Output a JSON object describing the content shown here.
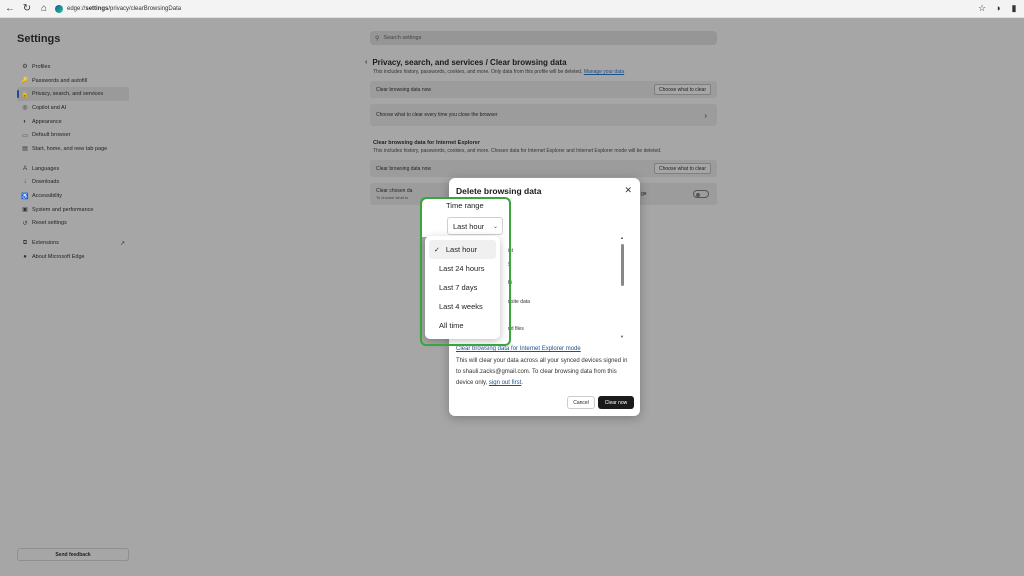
{
  "browser": {
    "url_prefix": "edge://",
    "url_bold": "settings",
    "url_rest": "/privacy/clearBrowsingData"
  },
  "settings": {
    "title": "Settings",
    "sidebar_group1": [
      {
        "icon": "⚙",
        "label": "Profiles"
      },
      {
        "icon": "🔑",
        "label": "Passwords and autofill"
      },
      {
        "icon": "🔒",
        "label": "Privacy, search, and services"
      },
      {
        "icon": "◎",
        "label": "Copilot and AI"
      },
      {
        "icon": "◐",
        "label": "Appearance"
      },
      {
        "icon": "▭",
        "label": "Default browser"
      },
      {
        "icon": "▤",
        "label": "Start, home, and new tab page"
      }
    ],
    "sidebar_group2": [
      {
        "icon": "A",
        "label": "Languages"
      },
      {
        "icon": "↓",
        "label": "Downloads"
      },
      {
        "icon": "♿",
        "label": "Accessibility"
      },
      {
        "icon": "▣",
        "label": "System and performance"
      },
      {
        "icon": "↺",
        "label": "Reset settings"
      }
    ],
    "sidebar_group3": [
      {
        "icon": "⧉",
        "label": "Extensions",
        "ext": "↗"
      },
      {
        "icon": "●",
        "label": "About Microsoft Edge"
      }
    ],
    "feedback": "Send feedback"
  },
  "main": {
    "search_placeholder": "Search settings",
    "breadcrumb": "Privacy, search, and services / Clear browsing data",
    "subtext": "This includes history, passwords, cookies, and more. Only data from this profile will be deleted.",
    "manage_link": "Manage your data",
    "row1_label": "Clear browsing data now",
    "row1_button": "Choose what to clear",
    "row2_label": "Choose what to clear every time you close the browser",
    "ie_heading": "Clear browsing data for Internet Explorer",
    "ie_sub": "This includes history, passwords, cookies, and more. Chosen data for Internet Explorer and Internet Explorer mode will be deleted.",
    "row3_label": "Clear browsing data now",
    "row3_button": "Choose what to clear",
    "row4_label": "Clear chosen da",
    "row4_small": "To choose what to",
    "row4_trail": "ge"
  },
  "dialog": {
    "title": "Delete browsing data",
    "partial_rows": [
      "ist",
      "y",
      "hi",
      "r site data",
      "nd files"
    ],
    "ie_link": "Clear browsing data for Internet Explorer mode",
    "info": "This will clear your data across all your synced devices signed in to shauli.zacks@gmail.com. To clear browsing data from this device only,",
    "signout": "sign out first",
    "signout_end": ".",
    "cancel": "Cancel",
    "clear": "Clear now"
  },
  "time_range": {
    "label": "Time range",
    "selected": "Last hour",
    "options": [
      "Last hour",
      "Last 24 hours",
      "Last 7 days",
      "Last 4 weeks",
      "All time"
    ]
  },
  "colors": {
    "highlight": "#3ba53b",
    "link": "#1d4f8c"
  }
}
